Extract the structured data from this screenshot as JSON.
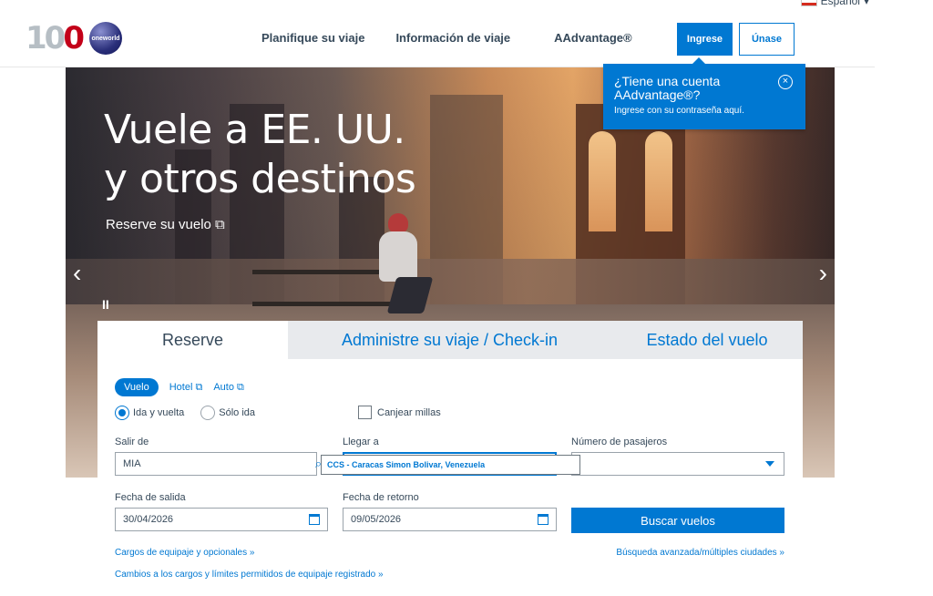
{
  "language": {
    "label": "Español"
  },
  "logo": {
    "text_main": "10",
    "text_o": "0",
    "oneworld": "oneworld"
  },
  "nav": {
    "items": [
      "Planifique su viaje",
      "Información de viaje",
      "AAdvantage®"
    ]
  },
  "auth": {
    "login": "Ingrese",
    "join": "Únase"
  },
  "popup": {
    "title": "¿Tiene una cuenta AAdvantage®?",
    "subtitle": "Ingrese con su contraseña aquí.",
    "close": "×"
  },
  "hero": {
    "title_line1": "Vuele a EE. UU.",
    "title_line2": "y otros destinos",
    "link": "Reserve su vuelo ⧉",
    "prev": "‹",
    "next": "›",
    "pause": "II"
  },
  "tabs": [
    "Reserve",
    "Administre su viaje / Check-in",
    "Estado del vuelo"
  ],
  "modes": {
    "flight": "Vuelo",
    "hotel": "Hotel ⧉",
    "car": "Auto ⧉"
  },
  "trip_type": {
    "round": "Ida y vuelta",
    "oneway": "Sólo ida",
    "selected": "round"
  },
  "miles": {
    "label": "Canjear millas"
  },
  "form": {
    "from_label": "Salir de",
    "from_value": "MIA",
    "to_label": "Llegar a",
    "to_value": "",
    "pax_label": "Número de pasajeros",
    "pax_value": "",
    "depart_label": "Fecha de salida",
    "depart_value": "30/04/2026",
    "return_label": "Fecha de retorno",
    "return_value": "09/05/2026",
    "suggestion": "CCS - Caracas Simon Bolivar, Venezuela",
    "search": "Buscar vuelos"
  },
  "links": {
    "baggage": "Cargos de equipaje y opcionales »",
    "advanced": "Búsqueda avanzada/múltiples ciudades »",
    "changes": "Cambios a los cargos y límites permitidos de equipaje registrado »"
  }
}
